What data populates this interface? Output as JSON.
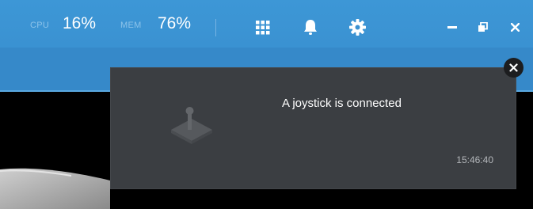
{
  "topbar": {
    "cpu_label": "CPU",
    "cpu_value": "16%",
    "mem_label": "MEM",
    "mem_value": "76%",
    "icons": [
      "apps-grid-icon",
      "bell-icon",
      "gear-icon",
      "minimize-icon",
      "restore-icon",
      "close-icon"
    ],
    "color": "#3a91d1"
  },
  "notification": {
    "message": "A joystick is connected",
    "time": "15:46:40",
    "icon": "joystick-icon",
    "background": "#3b3e42"
  }
}
